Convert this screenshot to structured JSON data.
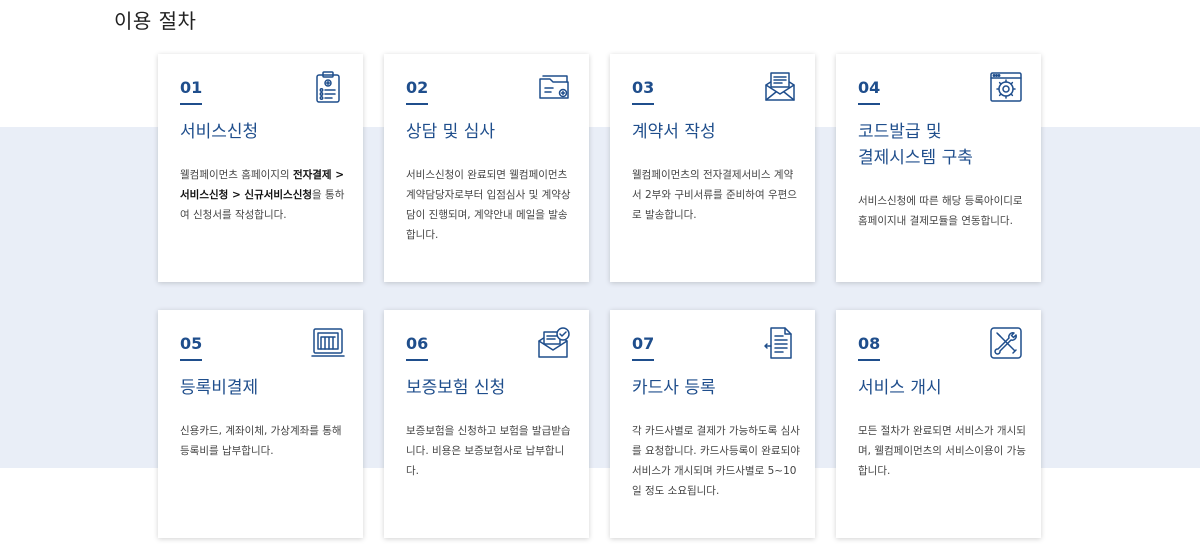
{
  "section_title": "이용 절차",
  "accent_color": "#1f4e8c",
  "band_color": "#e9eef7",
  "steps": [
    {
      "num": "01",
      "title": "서비스신청",
      "icon": "clipboard-icon",
      "desc_pre": "웰컴페이먼츠 홈페이지의 ",
      "desc_bold": "전자결제 > 서비스신청 > 신규서비스신청",
      "desc_post": "을 통하여 신청서를 작성합니다."
    },
    {
      "num": "02",
      "title": "상담 및 심사",
      "icon": "folder-icon",
      "desc": "서비스신청이 완료되면 웰컴페이먼츠 계약담당자로부터 입점심사 및 계약상담이 진행되며, 계약안내 메일을 발송합니다."
    },
    {
      "num": "03",
      "title": "계약서 작성",
      "icon": "mail-letter-icon",
      "desc": "웰컴페이먼츠의 전자결제서비스 계약서 2부와 구비서류를 준비하여 우편으로 발송합니다."
    },
    {
      "num": "04",
      "title_line1": "코드발급 및",
      "title_line2": "결제시스템 구축",
      "icon": "browser-gear-icon",
      "desc": "서비스신청에 따른 해당 등록아이디로 홈페이지내 결제모듈을 연동합니다."
    },
    {
      "num": "05",
      "title": "등록비결제",
      "icon": "payment-terminal-icon",
      "desc": "신용카드, 계좌이체, 가상계좌를 통해 등록비를 납부합니다."
    },
    {
      "num": "06",
      "title": "보증보험 신청",
      "icon": "mail-check-icon",
      "desc": "보증보험을 신청하고 보험을 발급받습니다. 비용은 보증보험사로 납부합니다."
    },
    {
      "num": "07",
      "title": "카드사 등록",
      "icon": "document-pen-icon",
      "desc": "각 카드사별로 결제가 가능하도록 심사를 요청합니다. 카드사등록이 완료되야 서비스가 개시되며 카드사별로 5~10일 정도 소요됩니다."
    },
    {
      "num": "08",
      "title": "서비스 개시",
      "icon": "tools-icon",
      "desc": "모든 절차가 완료되면 서비스가 개시되며, 웰컴페이먼츠의 서비스이용이 가능합니다."
    }
  ]
}
